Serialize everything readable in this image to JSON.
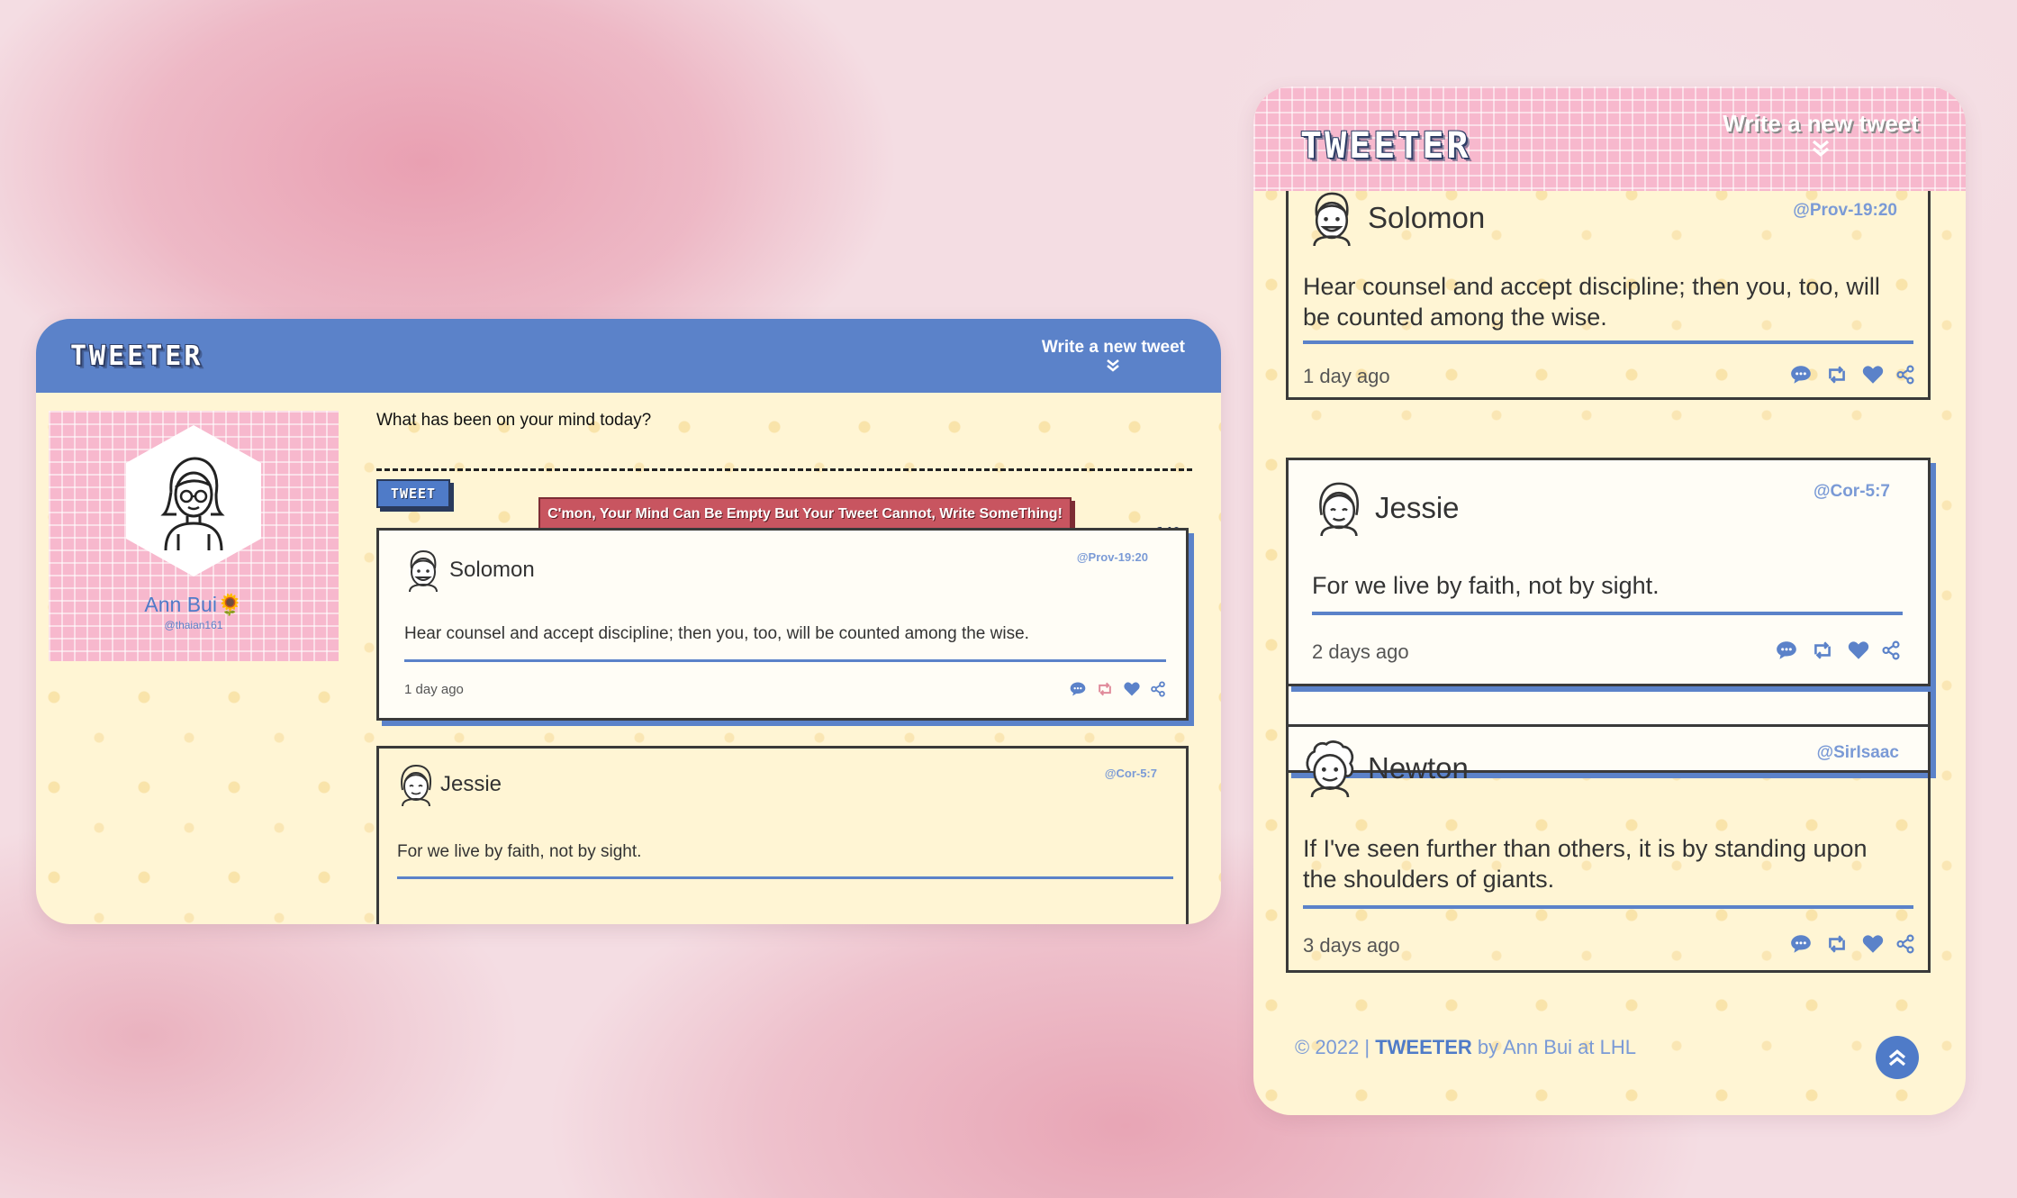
{
  "app": {
    "logo": "TWEETER",
    "write_new": "Write a new tweet"
  },
  "profile": {
    "name": "Ann Bui",
    "handle": "@thaian161",
    "emoji": "🌻"
  },
  "compose": {
    "label": "What has been on your mind today?",
    "tweet_button": "TWEET",
    "error": "C'mon, Your Mind Can Be Empty But Your Tweet Cannot, Write SomeThing!",
    "counter": "140"
  },
  "tweets": [
    {
      "name": "Solomon",
      "handle": "@Prov-19:20",
      "text": "Hear counsel and accept discipline; then you, too, will be counted among the wise.",
      "time": "1 day ago"
    },
    {
      "name": "Jessie",
      "handle": "@Cor-5:7",
      "text": "For we live by faith, not by sight.",
      "time": "2 days ago"
    },
    {
      "name": "Newton",
      "handle": "@SirIsaac",
      "text": "If I've seen further than others, it is by standing upon the shoulders of giants.",
      "time": "3 days ago"
    }
  ],
  "mobile_tweets": [
    {
      "name": "Solomon",
      "handle": "@Prov-19:20",
      "text_line1": "Hear counsel and accept discipline; then you, too, will",
      "text_line2": "be counted among the wise.",
      "time": "1 day ago"
    },
    {
      "name": "Jessie",
      "handle": "@Cor-5:7",
      "text_line1": "For we live by faith, not by sight.",
      "time": "2 days ago"
    },
    {
      "name": "Newton",
      "handle": "@SirIsaac",
      "text_line1": "If I've seen further than others, it is by standing upon",
      "text_line2": "the shoulders of giants.",
      "time": "3 days ago"
    }
  ],
  "footer": {
    "prefix": "© 2022 | ",
    "brand": "TWEETER",
    "suffix": " by Ann Bui at LHL"
  },
  "icons": [
    "chevron-double-down-icon",
    "avatar-icon",
    "comment-icon",
    "retweet-icon",
    "heart-icon",
    "share-icon",
    "chevron-double-up-icon"
  ],
  "colors": {
    "accent_blue": "#5b82c9",
    "error_red": "#c85560",
    "card_cream": "#fff5d4",
    "grid_pink": "#f7b8cd"
  }
}
